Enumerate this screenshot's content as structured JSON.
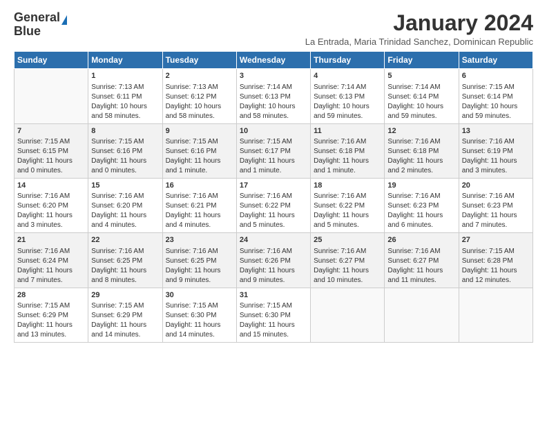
{
  "logo": {
    "line1": "General",
    "line2": "Blue"
  },
  "title": "January 2024",
  "subtitle": "La Entrada, Maria Trinidad Sanchez, Dominican Republic",
  "days": [
    "Sunday",
    "Monday",
    "Tuesday",
    "Wednesday",
    "Thursday",
    "Friday",
    "Saturday"
  ],
  "weeks": [
    [
      {
        "day": "",
        "content": ""
      },
      {
        "day": "1",
        "content": "Sunrise: 7:13 AM\nSunset: 6:11 PM\nDaylight: 10 hours\nand 58 minutes."
      },
      {
        "day": "2",
        "content": "Sunrise: 7:13 AM\nSunset: 6:12 PM\nDaylight: 10 hours\nand 58 minutes."
      },
      {
        "day": "3",
        "content": "Sunrise: 7:14 AM\nSunset: 6:13 PM\nDaylight: 10 hours\nand 58 minutes."
      },
      {
        "day": "4",
        "content": "Sunrise: 7:14 AM\nSunset: 6:13 PM\nDaylight: 10 hours\nand 59 minutes."
      },
      {
        "day": "5",
        "content": "Sunrise: 7:14 AM\nSunset: 6:14 PM\nDaylight: 10 hours\nand 59 minutes."
      },
      {
        "day": "6",
        "content": "Sunrise: 7:15 AM\nSunset: 6:14 PM\nDaylight: 10 hours\nand 59 minutes."
      }
    ],
    [
      {
        "day": "7",
        "content": "Sunrise: 7:15 AM\nSunset: 6:15 PM\nDaylight: 11 hours\nand 0 minutes."
      },
      {
        "day": "8",
        "content": "Sunrise: 7:15 AM\nSunset: 6:16 PM\nDaylight: 11 hours\nand 0 minutes."
      },
      {
        "day": "9",
        "content": "Sunrise: 7:15 AM\nSunset: 6:16 PM\nDaylight: 11 hours\nand 1 minute."
      },
      {
        "day": "10",
        "content": "Sunrise: 7:15 AM\nSunset: 6:17 PM\nDaylight: 11 hours\nand 1 minute."
      },
      {
        "day": "11",
        "content": "Sunrise: 7:16 AM\nSunset: 6:18 PM\nDaylight: 11 hours\nand 1 minute."
      },
      {
        "day": "12",
        "content": "Sunrise: 7:16 AM\nSunset: 6:18 PM\nDaylight: 11 hours\nand 2 minutes."
      },
      {
        "day": "13",
        "content": "Sunrise: 7:16 AM\nSunset: 6:19 PM\nDaylight: 11 hours\nand 3 minutes."
      }
    ],
    [
      {
        "day": "14",
        "content": "Sunrise: 7:16 AM\nSunset: 6:20 PM\nDaylight: 11 hours\nand 3 minutes."
      },
      {
        "day": "15",
        "content": "Sunrise: 7:16 AM\nSunset: 6:20 PM\nDaylight: 11 hours\nand 4 minutes."
      },
      {
        "day": "16",
        "content": "Sunrise: 7:16 AM\nSunset: 6:21 PM\nDaylight: 11 hours\nand 4 minutes."
      },
      {
        "day": "17",
        "content": "Sunrise: 7:16 AM\nSunset: 6:22 PM\nDaylight: 11 hours\nand 5 minutes."
      },
      {
        "day": "18",
        "content": "Sunrise: 7:16 AM\nSunset: 6:22 PM\nDaylight: 11 hours\nand 5 minutes."
      },
      {
        "day": "19",
        "content": "Sunrise: 7:16 AM\nSunset: 6:23 PM\nDaylight: 11 hours\nand 6 minutes."
      },
      {
        "day": "20",
        "content": "Sunrise: 7:16 AM\nSunset: 6:23 PM\nDaylight: 11 hours\nand 7 minutes."
      }
    ],
    [
      {
        "day": "21",
        "content": "Sunrise: 7:16 AM\nSunset: 6:24 PM\nDaylight: 11 hours\nand 7 minutes."
      },
      {
        "day": "22",
        "content": "Sunrise: 7:16 AM\nSunset: 6:25 PM\nDaylight: 11 hours\nand 8 minutes."
      },
      {
        "day": "23",
        "content": "Sunrise: 7:16 AM\nSunset: 6:25 PM\nDaylight: 11 hours\nand 9 minutes."
      },
      {
        "day": "24",
        "content": "Sunrise: 7:16 AM\nSunset: 6:26 PM\nDaylight: 11 hours\nand 9 minutes."
      },
      {
        "day": "25",
        "content": "Sunrise: 7:16 AM\nSunset: 6:27 PM\nDaylight: 11 hours\nand 10 minutes."
      },
      {
        "day": "26",
        "content": "Sunrise: 7:16 AM\nSunset: 6:27 PM\nDaylight: 11 hours\nand 11 minutes."
      },
      {
        "day": "27",
        "content": "Sunrise: 7:15 AM\nSunset: 6:28 PM\nDaylight: 11 hours\nand 12 minutes."
      }
    ],
    [
      {
        "day": "28",
        "content": "Sunrise: 7:15 AM\nSunset: 6:29 PM\nDaylight: 11 hours\nand 13 minutes."
      },
      {
        "day": "29",
        "content": "Sunrise: 7:15 AM\nSunset: 6:29 PM\nDaylight: 11 hours\nand 14 minutes."
      },
      {
        "day": "30",
        "content": "Sunrise: 7:15 AM\nSunset: 6:30 PM\nDaylight: 11 hours\nand 14 minutes."
      },
      {
        "day": "31",
        "content": "Sunrise: 7:15 AM\nSunset: 6:30 PM\nDaylight: 11 hours\nand 15 minutes."
      },
      {
        "day": "",
        "content": ""
      },
      {
        "day": "",
        "content": ""
      },
      {
        "day": "",
        "content": ""
      }
    ]
  ]
}
